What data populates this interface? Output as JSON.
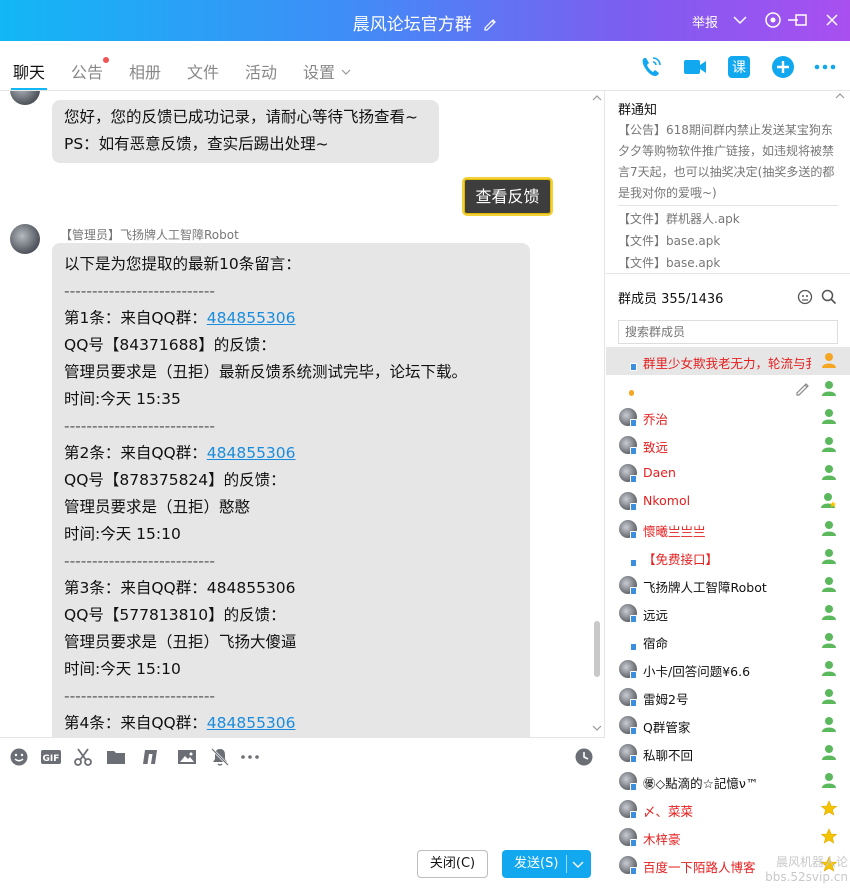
{
  "window": {
    "title": "晨风论坛官方群",
    "report_label": "举报"
  },
  "tabs": [
    {
      "label": "聊天",
      "active": true
    },
    {
      "label": "公告",
      "has_dot": true
    },
    {
      "label": "相册"
    },
    {
      "label": "文件"
    },
    {
      "label": "活动"
    },
    {
      "label": "设置"
    }
  ],
  "header_icons": [
    "phone-icon",
    "video-icon",
    "course-icon",
    "add-app-icon",
    "more-icon"
  ],
  "chat": {
    "msg1": {
      "line1": "您好，您的反馈已成功记录，请耐心等待飞扬查看~",
      "line2": "PS：如有恶意反馈，查实后踢出处理~"
    },
    "feedback_button": "查看反馈",
    "msg2": {
      "sender": "【管理员】飞扬牌人工智障Robot",
      "intro": "以下是为您提取的最新10条留言：",
      "divider": "---------------------------",
      "entries": [
        {
          "head": "第1条：来自QQ群：",
          "group": "484855306",
          "qq": "QQ号【84371688】的反馈：",
          "content": "管理员要求是（丑拒）最新反馈系统测试完毕，论坛下载。",
          "time": "时间:今天 15:35",
          "linked": true
        },
        {
          "head": "第2条：来自QQ群：",
          "group": "484855306",
          "qq": "QQ号【878375824】的反馈：",
          "content": "管理员要求是（丑拒）憨憨",
          "time": "时间:今天 15:10",
          "linked": true
        },
        {
          "head": "第3条：来自QQ群：",
          "group": "484855306",
          "qq": "QQ号【577813810】的反馈：",
          "content": "管理员要求是（丑拒）飞扬大傻逼",
          "time": "时间:今天 15:10",
          "linked": false
        },
        {
          "head": "第4条：来自QQ群：",
          "group": "484855306",
          "linked": true
        }
      ]
    }
  },
  "input": {
    "close_label": "关闭(C)",
    "send_label": "发送(S)"
  },
  "notice": {
    "title": "群通知",
    "text": "【公告】618期间群内禁止发送某宝狗东夕夕等购物软件推广链接，如违规将被禁言7天起，也可以抽奖决定(抽奖多送的都是我对你的爱哦~)",
    "files": [
      "【文件】群机器人.apk",
      "【文件】base.apk",
      "【文件】base.apk"
    ]
  },
  "members": {
    "title": "群成员 355/1436",
    "search_placeholder": "搜索群成员",
    "list": [
      {
        "name": "群里少女欺我老无力，轮流与我",
        "color": "red",
        "role": "owner",
        "avatar": "blank",
        "highlight": true
      },
      {
        "name": "",
        "color": "black",
        "role": "member",
        "avatar": "blank",
        "edit": true
      },
      {
        "name": "乔治",
        "color": "red",
        "role": "member"
      },
      {
        "name": "致远",
        "color": "red",
        "role": "member"
      },
      {
        "name": "Daen",
        "color": "red",
        "role": "member"
      },
      {
        "name": "Nkomol",
        "color": "red",
        "role": "member-star"
      },
      {
        "name": "懷曦亗亗亗",
        "color": "red",
        "role": "member"
      },
      {
        "name": "【免费接口】",
        "color": "red",
        "role": "member",
        "avatar": "blank"
      },
      {
        "name": "飞扬牌人工智障Robot",
        "color": "black",
        "role": "member"
      },
      {
        "name": "远远",
        "color": "black",
        "role": "member"
      },
      {
        "name": "宿命",
        "color": "black",
        "role": "member",
        "avatar": "blank"
      },
      {
        "name": "小卡/回答问题¥6.6",
        "color": "black",
        "role": "member"
      },
      {
        "name": "雷姆2号",
        "color": "black",
        "role": "member"
      },
      {
        "name": "Q群管家",
        "color": "black",
        "role": "member"
      },
      {
        "name": "私聊不回",
        "color": "black",
        "role": "member"
      },
      {
        "name": "㊝◇點滴的☆記憶ν™",
        "color": "black",
        "role": "member"
      },
      {
        "name": "〆、菜菜",
        "color": "red",
        "role": "star"
      },
      {
        "name": "木梓豪",
        "color": "red",
        "role": "star"
      },
      {
        "name": "百度一下陌路人博客",
        "color": "red",
        "role": "star"
      }
    ]
  },
  "watermark": {
    "line1": "晨风机器人论",
    "line2": "bbs.52svip.cn"
  },
  "colors": {
    "accent": "#12b7f5",
    "admin_red": "#e62020",
    "link": "#1a8cde"
  }
}
